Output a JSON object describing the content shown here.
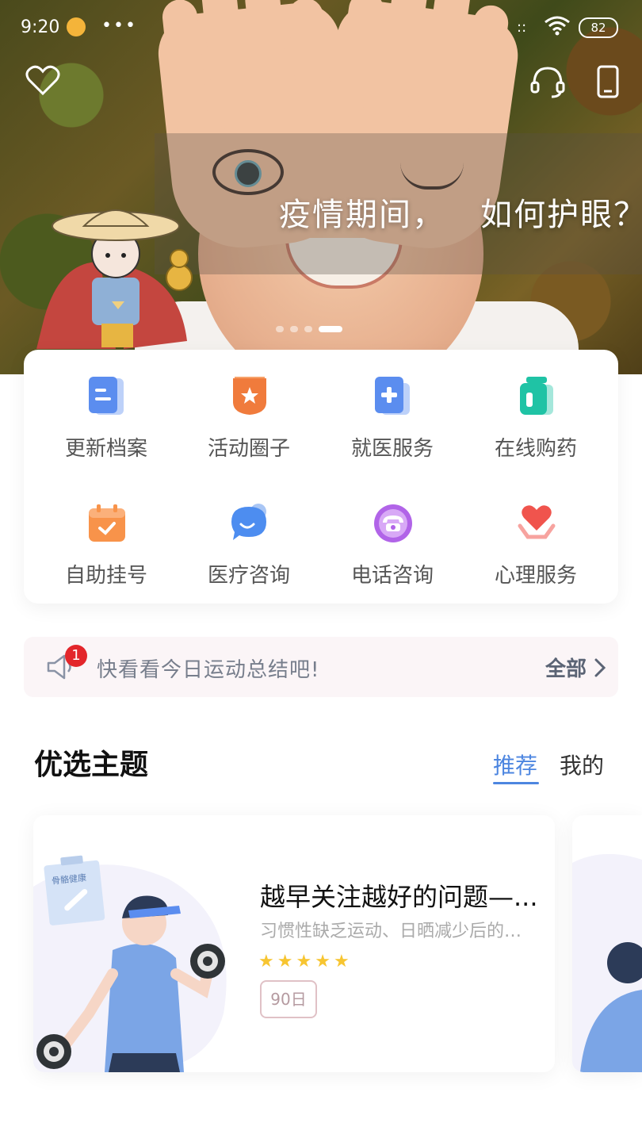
{
  "status_bar": {
    "time": "9:20",
    "battery": "82"
  },
  "banner": {
    "title": "疫情期间，   如何护眼？",
    "slides": 4,
    "active_slide": 3
  },
  "quick_actions": [
    {
      "label": "更新档案",
      "icon": "document-icon",
      "color": "#5b8def"
    },
    {
      "label": "活动圈子",
      "icon": "star-badge-icon",
      "color": "#f07b3c"
    },
    {
      "label": "就医服务",
      "icon": "medical-doc-icon",
      "color": "#5b8def"
    },
    {
      "label": "在线购药",
      "icon": "medicine-bottle-icon",
      "color": "#1fc3a5"
    },
    {
      "label": "自助挂号",
      "icon": "calendar-check-icon",
      "color": "#f8934a"
    },
    {
      "label": "医疗咨询",
      "icon": "chat-bubble-icon",
      "color": "#4d8df0"
    },
    {
      "label": "电话咨询",
      "icon": "phone-icon",
      "color": "#b164e8"
    },
    {
      "label": "心理服务",
      "icon": "heart-hand-icon",
      "color": "#f0544d"
    }
  ],
  "notice": {
    "badge": "1",
    "text": "快看看今日运动总结吧!",
    "all_label": "全部"
  },
  "section": {
    "title": "优选主题",
    "tabs": [
      "推荐",
      "我的"
    ],
    "active_tab": "推荐"
  },
  "topic": {
    "illustration_label": "骨骼健康",
    "title": "越早关注越好的问题—...",
    "description": "习惯性缺乏运动、日晒减少后的…",
    "rating": 5,
    "tag": "90日"
  }
}
